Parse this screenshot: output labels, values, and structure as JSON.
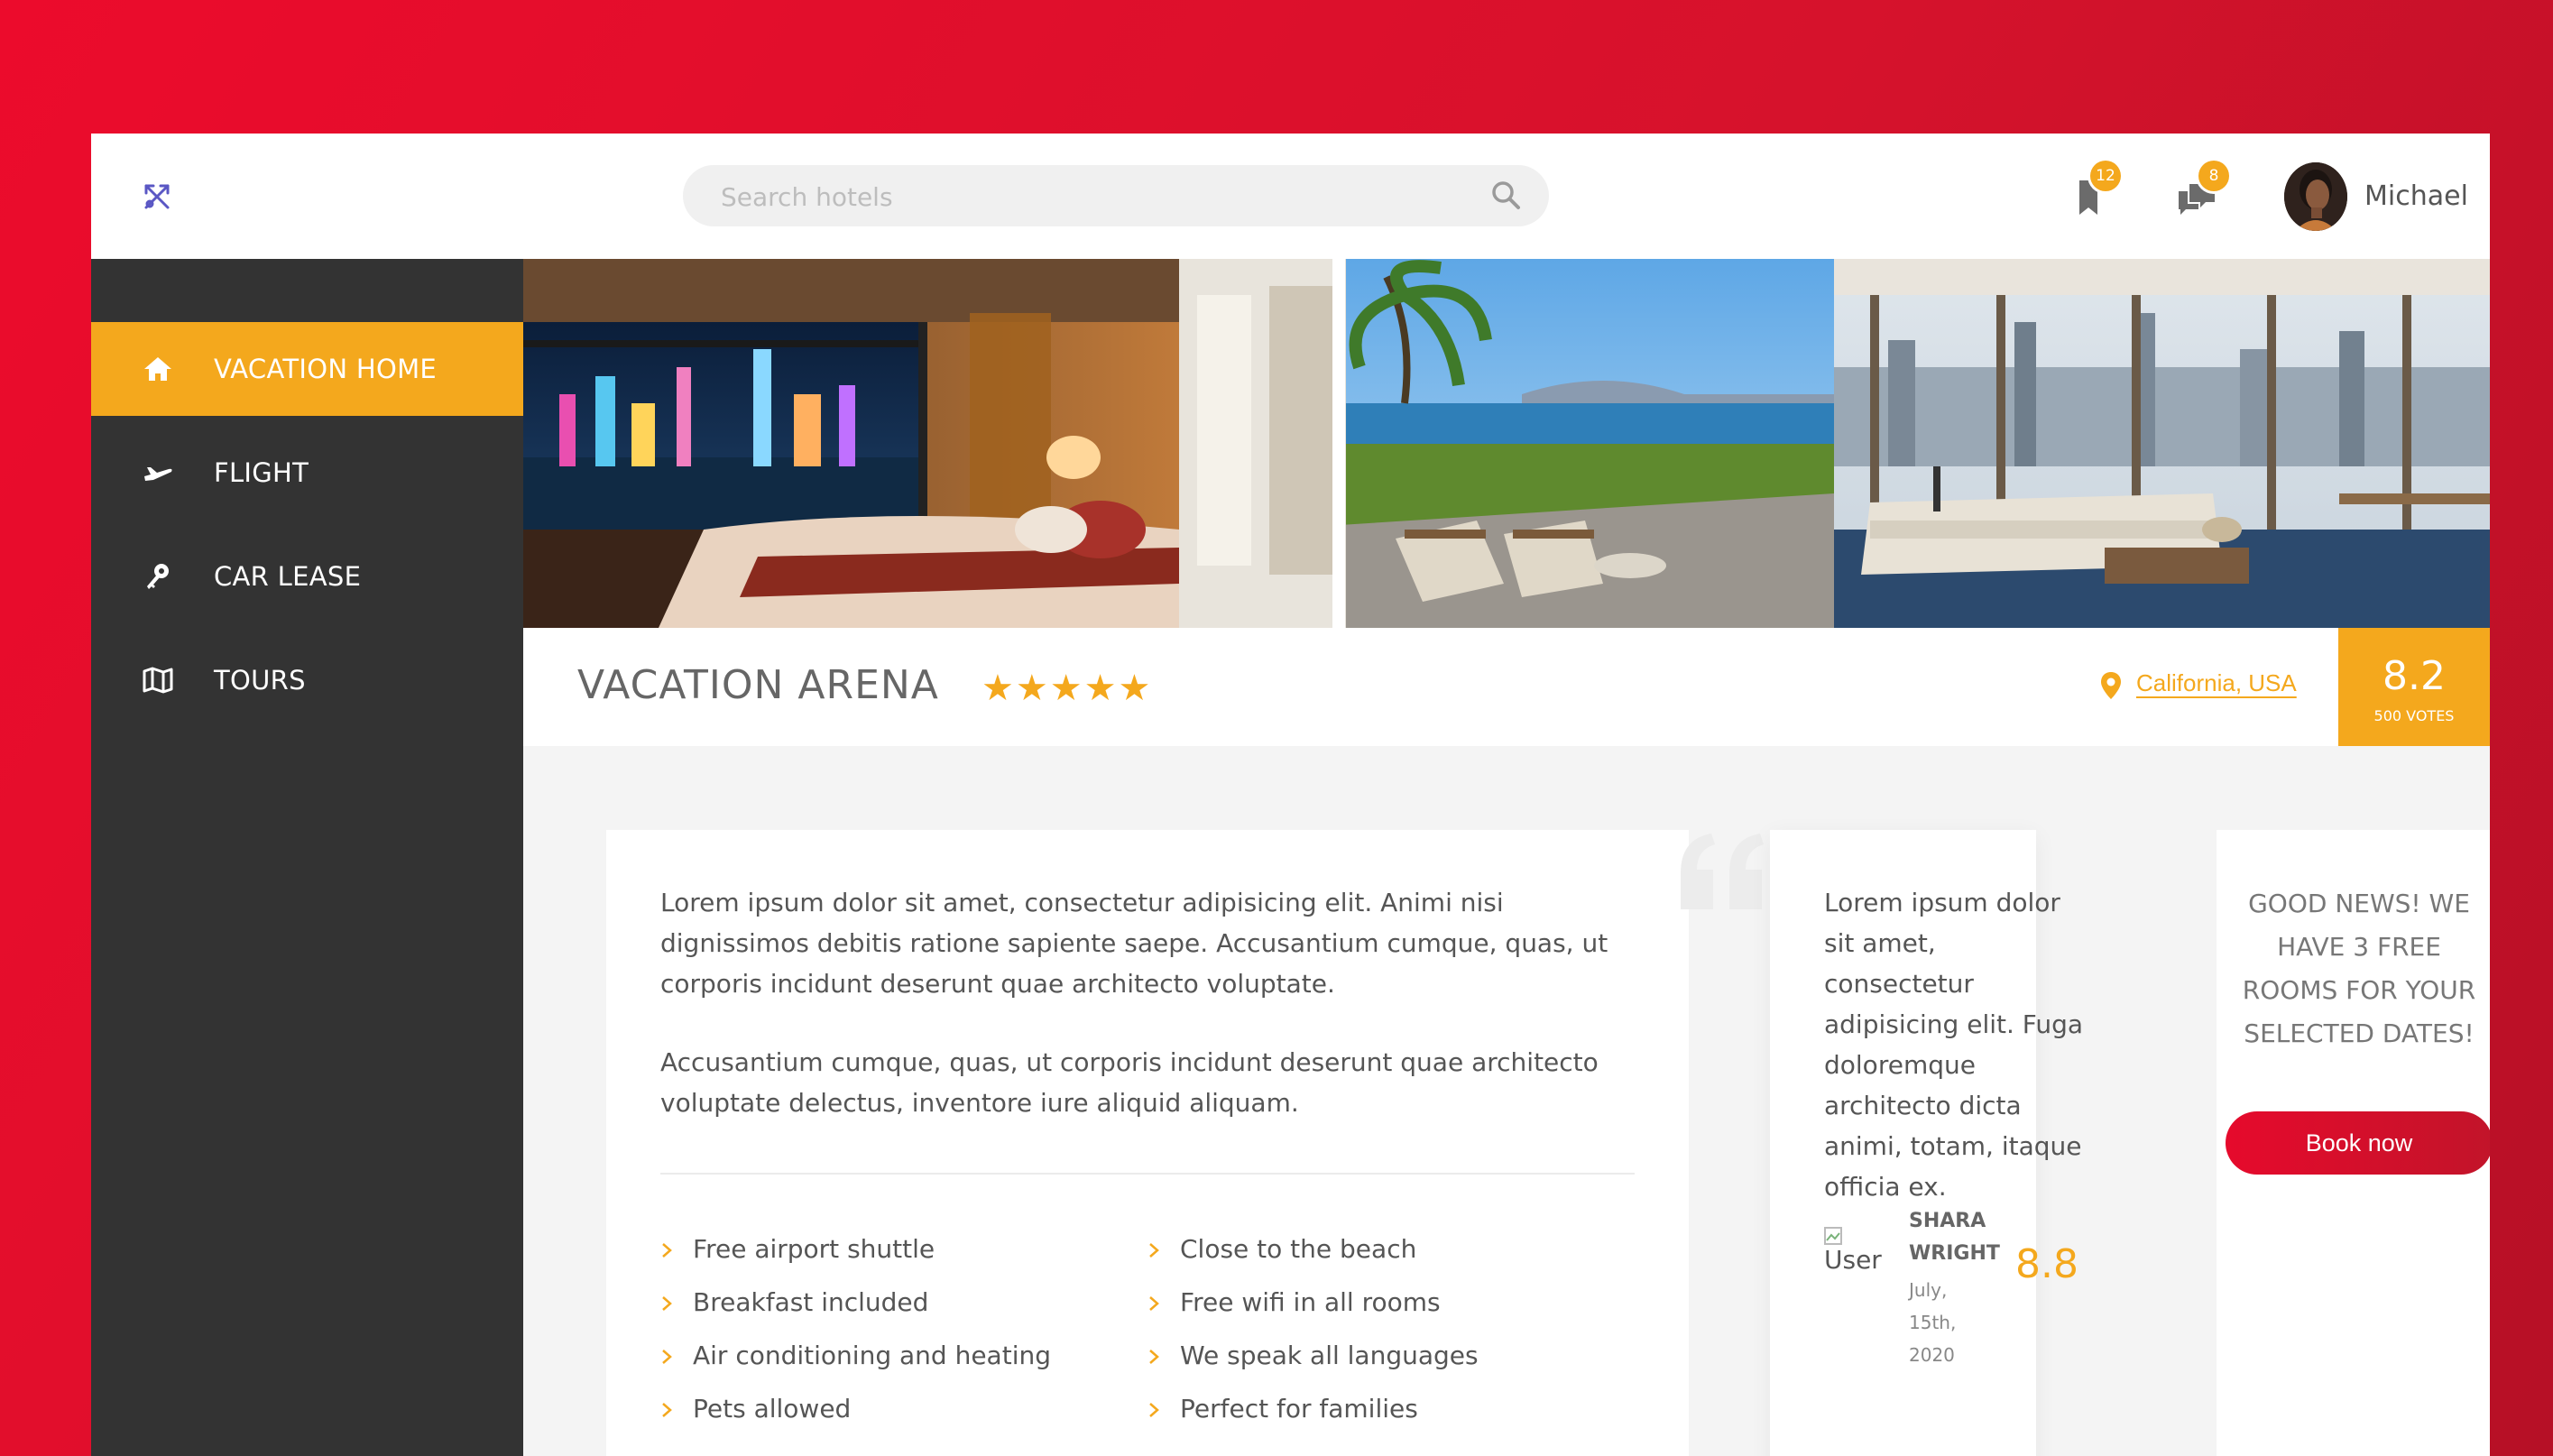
{
  "header": {
    "search": {
      "placeholder": "Search hotels"
    },
    "bookmarks_badge": "12",
    "messages_badge": "8",
    "user_name": "Michael"
  },
  "sidebar": {
    "items": [
      {
        "label": "VACATION HOME",
        "icon": "home-icon",
        "active": true
      },
      {
        "label": "FLIGHT",
        "icon": "plane-icon",
        "active": false
      },
      {
        "label": "CAR LEASE",
        "icon": "key-icon",
        "active": false
      },
      {
        "label": "TOURS",
        "icon": "map-icon",
        "active": false
      }
    ]
  },
  "hotel": {
    "name": "VACATION ARENA",
    "stars": "★★★★★",
    "star_count": 5,
    "location": "California, USA",
    "score": "8.2",
    "votes": "500 VOTES"
  },
  "description": {
    "paragraphs": [
      "Lorem ipsum dolor sit amet, consectetur adipisicing elit. Animi nisi dignissimos debitis ratione sapiente saepe. Accusantium cumque, quas, ut corporis incidunt deserunt quae architecto voluptate.",
      "Accusantium cumque, quas, ut corporis incidunt deserunt quae architecto voluptate delectus, inventore iure aliquid aliquam."
    ],
    "features_left": [
      "Free airport shuttle",
      "Breakfast included",
      "Air conditioning and heating",
      "Pets allowed"
    ],
    "features_right": [
      "Close to the beach",
      "Free wifi in all rooms",
      "We speak all languages",
      "Perfect for families"
    ]
  },
  "review": {
    "text": "Lorem ipsum dolor sit amet, consectetur adipisicing elit. Fuga doloremque architecto dicta animi, totam, itaque officia ex.",
    "user_img_alt": "User",
    "name": "SHARA WRIGHT",
    "date": "July, 15th, 2020",
    "score": "8.8"
  },
  "booking": {
    "message": "GOOD NEWS! WE HAVE 3 FREE ROOMS FOR YOUR SELECTED DATES!",
    "button_label": "Book now"
  },
  "colors": {
    "accent": "#f4a81d",
    "sidebar_bg": "#333333",
    "brand_red": "#e60a2c",
    "logo": "#5a57c4"
  }
}
